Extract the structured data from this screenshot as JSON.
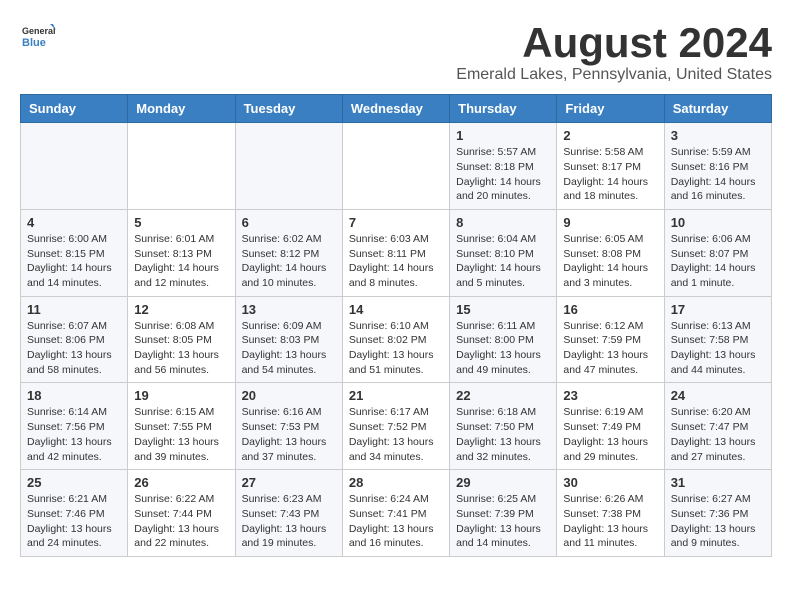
{
  "header": {
    "logo_general": "General",
    "logo_blue": "Blue",
    "month_title": "August 2024",
    "location": "Emerald Lakes, Pennsylvania, United States"
  },
  "weekdays": [
    "Sunday",
    "Monday",
    "Tuesday",
    "Wednesday",
    "Thursday",
    "Friday",
    "Saturday"
  ],
  "weeks": [
    [
      {
        "day": "",
        "content": ""
      },
      {
        "day": "",
        "content": ""
      },
      {
        "day": "",
        "content": ""
      },
      {
        "day": "",
        "content": ""
      },
      {
        "day": "1",
        "content": "Sunrise: 5:57 AM\nSunset: 8:18 PM\nDaylight: 14 hours\nand 20 minutes."
      },
      {
        "day": "2",
        "content": "Sunrise: 5:58 AM\nSunset: 8:17 PM\nDaylight: 14 hours\nand 18 minutes."
      },
      {
        "day": "3",
        "content": "Sunrise: 5:59 AM\nSunset: 8:16 PM\nDaylight: 14 hours\nand 16 minutes."
      }
    ],
    [
      {
        "day": "4",
        "content": "Sunrise: 6:00 AM\nSunset: 8:15 PM\nDaylight: 14 hours\nand 14 minutes."
      },
      {
        "day": "5",
        "content": "Sunrise: 6:01 AM\nSunset: 8:13 PM\nDaylight: 14 hours\nand 12 minutes."
      },
      {
        "day": "6",
        "content": "Sunrise: 6:02 AM\nSunset: 8:12 PM\nDaylight: 14 hours\nand 10 minutes."
      },
      {
        "day": "7",
        "content": "Sunrise: 6:03 AM\nSunset: 8:11 PM\nDaylight: 14 hours\nand 8 minutes."
      },
      {
        "day": "8",
        "content": "Sunrise: 6:04 AM\nSunset: 8:10 PM\nDaylight: 14 hours\nand 5 minutes."
      },
      {
        "day": "9",
        "content": "Sunrise: 6:05 AM\nSunset: 8:08 PM\nDaylight: 14 hours\nand 3 minutes."
      },
      {
        "day": "10",
        "content": "Sunrise: 6:06 AM\nSunset: 8:07 PM\nDaylight: 14 hours\nand 1 minute."
      }
    ],
    [
      {
        "day": "11",
        "content": "Sunrise: 6:07 AM\nSunset: 8:06 PM\nDaylight: 13 hours\nand 58 minutes."
      },
      {
        "day": "12",
        "content": "Sunrise: 6:08 AM\nSunset: 8:05 PM\nDaylight: 13 hours\nand 56 minutes."
      },
      {
        "day": "13",
        "content": "Sunrise: 6:09 AM\nSunset: 8:03 PM\nDaylight: 13 hours\nand 54 minutes."
      },
      {
        "day": "14",
        "content": "Sunrise: 6:10 AM\nSunset: 8:02 PM\nDaylight: 13 hours\nand 51 minutes."
      },
      {
        "day": "15",
        "content": "Sunrise: 6:11 AM\nSunset: 8:00 PM\nDaylight: 13 hours\nand 49 minutes."
      },
      {
        "day": "16",
        "content": "Sunrise: 6:12 AM\nSunset: 7:59 PM\nDaylight: 13 hours\nand 47 minutes."
      },
      {
        "day": "17",
        "content": "Sunrise: 6:13 AM\nSunset: 7:58 PM\nDaylight: 13 hours\nand 44 minutes."
      }
    ],
    [
      {
        "day": "18",
        "content": "Sunrise: 6:14 AM\nSunset: 7:56 PM\nDaylight: 13 hours\nand 42 minutes."
      },
      {
        "day": "19",
        "content": "Sunrise: 6:15 AM\nSunset: 7:55 PM\nDaylight: 13 hours\nand 39 minutes."
      },
      {
        "day": "20",
        "content": "Sunrise: 6:16 AM\nSunset: 7:53 PM\nDaylight: 13 hours\nand 37 minutes."
      },
      {
        "day": "21",
        "content": "Sunrise: 6:17 AM\nSunset: 7:52 PM\nDaylight: 13 hours\nand 34 minutes."
      },
      {
        "day": "22",
        "content": "Sunrise: 6:18 AM\nSunset: 7:50 PM\nDaylight: 13 hours\nand 32 minutes."
      },
      {
        "day": "23",
        "content": "Sunrise: 6:19 AM\nSunset: 7:49 PM\nDaylight: 13 hours\nand 29 minutes."
      },
      {
        "day": "24",
        "content": "Sunrise: 6:20 AM\nSunset: 7:47 PM\nDaylight: 13 hours\nand 27 minutes."
      }
    ],
    [
      {
        "day": "25",
        "content": "Sunrise: 6:21 AM\nSunset: 7:46 PM\nDaylight: 13 hours\nand 24 minutes."
      },
      {
        "day": "26",
        "content": "Sunrise: 6:22 AM\nSunset: 7:44 PM\nDaylight: 13 hours\nand 22 minutes."
      },
      {
        "day": "27",
        "content": "Sunrise: 6:23 AM\nSunset: 7:43 PM\nDaylight: 13 hours\nand 19 minutes."
      },
      {
        "day": "28",
        "content": "Sunrise: 6:24 AM\nSunset: 7:41 PM\nDaylight: 13 hours\nand 16 minutes."
      },
      {
        "day": "29",
        "content": "Sunrise: 6:25 AM\nSunset: 7:39 PM\nDaylight: 13 hours\nand 14 minutes."
      },
      {
        "day": "30",
        "content": "Sunrise: 6:26 AM\nSunset: 7:38 PM\nDaylight: 13 hours\nand 11 minutes."
      },
      {
        "day": "31",
        "content": "Sunrise: 6:27 AM\nSunset: 7:36 PM\nDaylight: 13 hours\nand 9 minutes."
      }
    ]
  ]
}
